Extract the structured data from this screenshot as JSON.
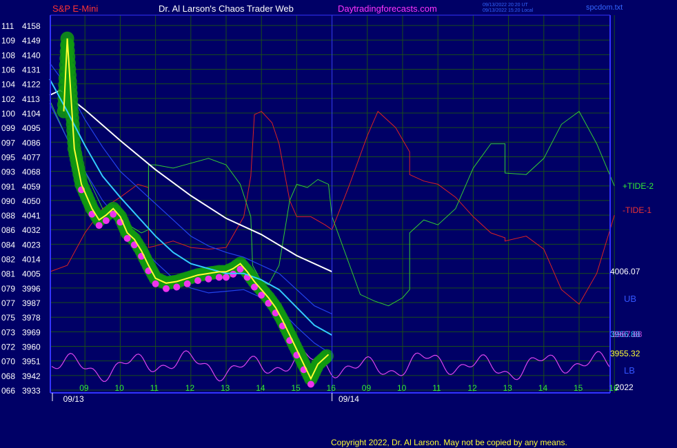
{
  "header": {
    "symbol": "S&P E-Mini",
    "site": "Dr. Al Larson's Chaos Trader Web",
    "url": "Daytradingforecasts.com",
    "stamp1": "09/13/2022 20:20 UT",
    "stamp2": "09/13/2022 15:20 Local",
    "file": "spcdom.txt"
  },
  "copyright": "Copyright 2022, Dr. Al Larson. May not be copied by any means.",
  "right_labels": {
    "tide2": "+TIDE-2",
    "tide1": "-TIDE-1",
    "last_white": "4006.07",
    "ub": "UB",
    "cyan_val": "3966.88",
    "e_val": "3967.88",
    "yellow_val": "3955.32",
    "lb": "LB",
    "year": "2022"
  },
  "colors": {
    "bg": "#000066",
    "grid": "#1a4d1a",
    "axis": "#3333ff",
    "price": "#ffff33",
    "cyan": "#33ccff",
    "white": "#ffffff",
    "blue": "#2244ee",
    "green": "#33cc33",
    "red": "#dd2222",
    "magenta": "#dd44ee",
    "dot_green": "#119911",
    "dot_magenta": "#ee33ee"
  },
  "chart_data": {
    "type": "line",
    "y_labels": [
      {
        "idx": "111",
        "price": "4158"
      },
      {
        "idx": "109",
        "price": "4149"
      },
      {
        "idx": "108",
        "price": "4140"
      },
      {
        "idx": "106",
        "price": "4131"
      },
      {
        "idx": "104",
        "price": "4122"
      },
      {
        "idx": "102",
        "price": "4113"
      },
      {
        "idx": "100",
        "price": "4104"
      },
      {
        "idx": "099",
        "price": "4095"
      },
      {
        "idx": "097",
        "price": "4086"
      },
      {
        "idx": "095",
        "price": "4077"
      },
      {
        "idx": "093",
        "price": "4068"
      },
      {
        "idx": "091",
        "price": "4059"
      },
      {
        "idx": "090",
        "price": "4050"
      },
      {
        "idx": "088",
        "price": "4041"
      },
      {
        "idx": "086",
        "price": "4032"
      },
      {
        "idx": "084",
        "price": "4023"
      },
      {
        "idx": "082",
        "price": "4014"
      },
      {
        "idx": "081",
        "price": "4005"
      },
      {
        "idx": "079",
        "price": "3996"
      },
      {
        "idx": "077",
        "price": "3987"
      },
      {
        "idx": "075",
        "price": "3978"
      },
      {
        "idx": "073",
        "price": "3969"
      },
      {
        "idx": "072",
        "price": "3960"
      },
      {
        "idx": "070",
        "price": "3951"
      },
      {
        "idx": "068",
        "price": "3942"
      },
      {
        "idx": "066",
        "price": "3933"
      }
    ],
    "ylim": [
      3933,
      4158
    ],
    "x_hour_labels": [
      "09",
      "10",
      "11",
      "12",
      "13",
      "14",
      "15",
      "16",
      "09",
      "10",
      "11",
      "12",
      "13",
      "14",
      "15",
      "16"
    ],
    "x_date_labels": [
      "09/13",
      "09/14"
    ],
    "series": [
      {
        "key": "price",
        "points": [
          [
            8.4,
            4105
          ],
          [
            8.5,
            4150
          ],
          [
            8.7,
            4082
          ],
          [
            8.9,
            4060
          ],
          [
            9.2,
            4045
          ],
          [
            9.4,
            4038
          ],
          [
            9.6,
            4041
          ],
          [
            9.8,
            4045
          ],
          [
            10.0,
            4040
          ],
          [
            10.2,
            4030
          ],
          [
            10.4,
            4026
          ],
          [
            10.6,
            4019
          ],
          [
            10.8,
            4010
          ],
          [
            11.0,
            4002
          ],
          [
            11.3,
            3999
          ],
          [
            11.6,
            4000
          ],
          [
            11.9,
            4002
          ],
          [
            12.2,
            4004
          ],
          [
            12.5,
            4005
          ],
          [
            12.8,
            4006
          ],
          [
            13.0,
            4006
          ],
          [
            13.2,
            4008
          ],
          [
            13.4,
            4011
          ],
          [
            13.6,
            4006
          ],
          [
            13.8,
            4000
          ],
          [
            14.0,
            3995
          ],
          [
            14.2,
            3990
          ],
          [
            14.4,
            3984
          ],
          [
            14.6,
            3976
          ],
          [
            14.8,
            3967
          ],
          [
            15.0,
            3958
          ],
          [
            15.2,
            3949
          ],
          [
            15.4,
            3940
          ],
          [
            15.6,
            3949
          ],
          [
            15.8,
            3953
          ],
          [
            15.9,
            3955
          ]
        ]
      },
      {
        "key": "cyan",
        "points": [
          [
            8.0,
            4125
          ],
          [
            8.5,
            4105
          ],
          [
            9.0,
            4084
          ],
          [
            9.5,
            4065
          ],
          [
            10.0,
            4052
          ],
          [
            10.5,
            4040
          ],
          [
            11.0,
            4028
          ],
          [
            11.5,
            4018
          ],
          [
            12.0,
            4011
          ],
          [
            12.5,
            4008
          ],
          [
            13.0,
            4005
          ],
          [
            13.5,
            4005
          ],
          [
            14.0,
            4001
          ],
          [
            14.5,
            3995
          ],
          [
            15.0,
            3984
          ],
          [
            15.5,
            3973
          ],
          [
            16.0,
            3966.88
          ]
        ]
      },
      {
        "key": "white",
        "points": [
          [
            8.0,
            4115
          ],
          [
            8.3,
            4118
          ],
          [
            9.0,
            4106
          ],
          [
            10.0,
            4087
          ],
          [
            11.0,
            4069
          ],
          [
            12.0,
            4053
          ],
          [
            13.0,
            4039
          ],
          [
            14.0,
            4029
          ],
          [
            15.0,
            4016
          ],
          [
            16.0,
            4006.07
          ]
        ]
      },
      {
        "key": "ub",
        "points": [
          [
            8.0,
            4135
          ],
          [
            8.5,
            4120
          ],
          [
            9.0,
            4100
          ],
          [
            9.5,
            4083
          ],
          [
            10.0,
            4068
          ],
          [
            10.5,
            4058
          ],
          [
            11.0,
            4048
          ],
          [
            11.5,
            4038
          ],
          [
            12.0,
            4028
          ],
          [
            12.5,
            4022
          ],
          [
            13.0,
            4018
          ],
          [
            13.5,
            4015
          ],
          [
            14.0,
            4010
          ],
          [
            14.5,
            4005
          ],
          [
            15.0,
            3995
          ],
          [
            15.5,
            3985
          ],
          [
            16.0,
            3980
          ]
        ]
      },
      {
        "key": "lb",
        "points": [
          [
            8.0,
            4110
          ],
          [
            8.5,
            4088
          ],
          [
            9.0,
            4068
          ],
          [
            9.5,
            4050
          ],
          [
            10.0,
            4037
          ],
          [
            10.5,
            4024
          ],
          [
            11.0,
            4012
          ],
          [
            11.5,
            4002
          ],
          [
            12.0,
            3996
          ],
          [
            12.5,
            3993
          ],
          [
            13.0,
            3994
          ],
          [
            13.5,
            3995
          ],
          [
            14.0,
            3990
          ],
          [
            14.5,
            3983
          ],
          [
            15.0,
            3972
          ],
          [
            15.5,
            3962
          ],
          [
            16.0,
            3955
          ]
        ]
      },
      {
        "key": "tide2",
        "points": [
          [
            8.0,
            4112
          ],
          [
            8.5,
            4088
          ],
          [
            9.0,
            4068
          ],
          [
            9.5,
            4045
          ],
          [
            10.0,
            4038
          ],
          [
            10.6,
            4030
          ],
          [
            10.8,
            4032
          ],
          [
            10.8,
            4072
          ],
          [
            11.0,
            4072
          ],
          [
            11.5,
            4070
          ],
          [
            12.0,
            4073
          ],
          [
            12.5,
            4076
          ],
          [
            13.0,
            4072
          ],
          [
            13.4,
            4060
          ],
          [
            13.7,
            4040
          ],
          [
            13.75,
            4010
          ],
          [
            14.0,
            4000
          ],
          [
            14.2,
            3998
          ],
          [
            14.5,
            4010
          ],
          [
            14.8,
            4050
          ],
          [
            15.0,
            4060
          ],
          [
            15.3,
            4058
          ],
          [
            15.6,
            4063
          ],
          [
            15.9,
            4060
          ],
          [
            16.0,
            4040
          ],
          [
            16.5,
            4010
          ],
          [
            16.8,
            3992
          ],
          [
            17.2,
            3988
          ],
          [
            17.6,
            3985
          ],
          [
            18.0,
            3990
          ],
          [
            18.2,
            3995
          ],
          [
            18.2,
            4030
          ],
          [
            18.6,
            4038
          ],
          [
            19.0,
            4035
          ],
          [
            19.5,
            4045
          ],
          [
            20.0,
            4070
          ],
          [
            20.5,
            4085
          ],
          [
            20.9,
            4085
          ],
          [
            20.9,
            4067
          ],
          [
            21.5,
            4066
          ],
          [
            22.0,
            4076
          ],
          [
            22.5,
            4097
          ],
          [
            23.0,
            4105
          ],
          [
            23.5,
            4085
          ],
          [
            24.0,
            4059
          ]
        ]
      },
      {
        "key": "tide1",
        "points": [
          [
            8.0,
            4006
          ],
          [
            8.5,
            4010
          ],
          [
            9.0,
            4030
          ],
          [
            9.5,
            4045
          ],
          [
            10.0,
            4052
          ],
          [
            10.5,
            4060
          ],
          [
            10.8,
            4058
          ],
          [
            10.8,
            4021
          ],
          [
            11.0,
            4022
          ],
          [
            11.5,
            4025
          ],
          [
            12.0,
            4021
          ],
          [
            12.5,
            4020
          ],
          [
            13.0,
            4021
          ],
          [
            13.5,
            4040
          ],
          [
            13.7,
            4065
          ],
          [
            13.8,
            4103
          ],
          [
            14.0,
            4105
          ],
          [
            14.3,
            4098
          ],
          [
            14.5,
            4085
          ],
          [
            14.8,
            4050
          ],
          [
            15.0,
            4040
          ],
          [
            15.4,
            4040
          ],
          [
            15.8,
            4035
          ],
          [
            16.0,
            4032
          ],
          [
            16.5,
            4060
          ],
          [
            17.0,
            4090
          ],
          [
            17.3,
            4105
          ],
          [
            17.8,
            4095
          ],
          [
            18.2,
            4080
          ],
          [
            18.2,
            4066
          ],
          [
            18.6,
            4062
          ],
          [
            19.0,
            4060
          ],
          [
            19.5,
            4052
          ],
          [
            20.0,
            4040
          ],
          [
            20.5,
            4030
          ],
          [
            20.9,
            4027
          ],
          [
            20.9,
            4025
          ],
          [
            21.5,
            4028
          ],
          [
            22.0,
            4020
          ],
          [
            22.5,
            3995
          ],
          [
            23.0,
            3986
          ],
          [
            23.5,
            4005
          ],
          [
            24.0,
            4041
          ]
        ]
      }
    ]
  }
}
